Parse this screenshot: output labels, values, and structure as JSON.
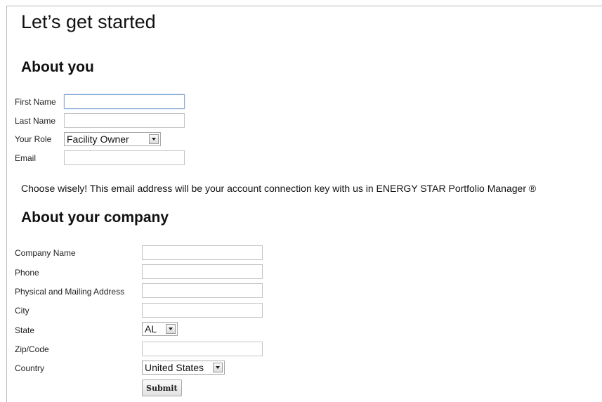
{
  "page": {
    "title": "Let’s get started"
  },
  "about_you": {
    "title": "About you",
    "fields": {
      "first_name": {
        "label": "First Name",
        "value": ""
      },
      "last_name": {
        "label": "Last Name",
        "value": ""
      },
      "role": {
        "label": "Your Role",
        "value": "Facility Owner"
      },
      "email": {
        "label": "Email",
        "value": ""
      }
    },
    "note": "Choose wisely! This email address will be your account connection key with us in ENERGY STAR Portfolio Manager ®"
  },
  "about_company": {
    "title": "About your company",
    "fields": {
      "company_name": {
        "label": "Company Name",
        "value": ""
      },
      "phone": {
        "label": "Phone",
        "value": ""
      },
      "address": {
        "label": "Physical and Mailing Address",
        "value": ""
      },
      "city": {
        "label": "City",
        "value": ""
      },
      "state": {
        "label": "State",
        "value": "AL"
      },
      "zip": {
        "label": "Zip/Code",
        "value": ""
      },
      "country": {
        "label": "Country",
        "value": "United States"
      }
    },
    "submit_label": "Submit"
  }
}
